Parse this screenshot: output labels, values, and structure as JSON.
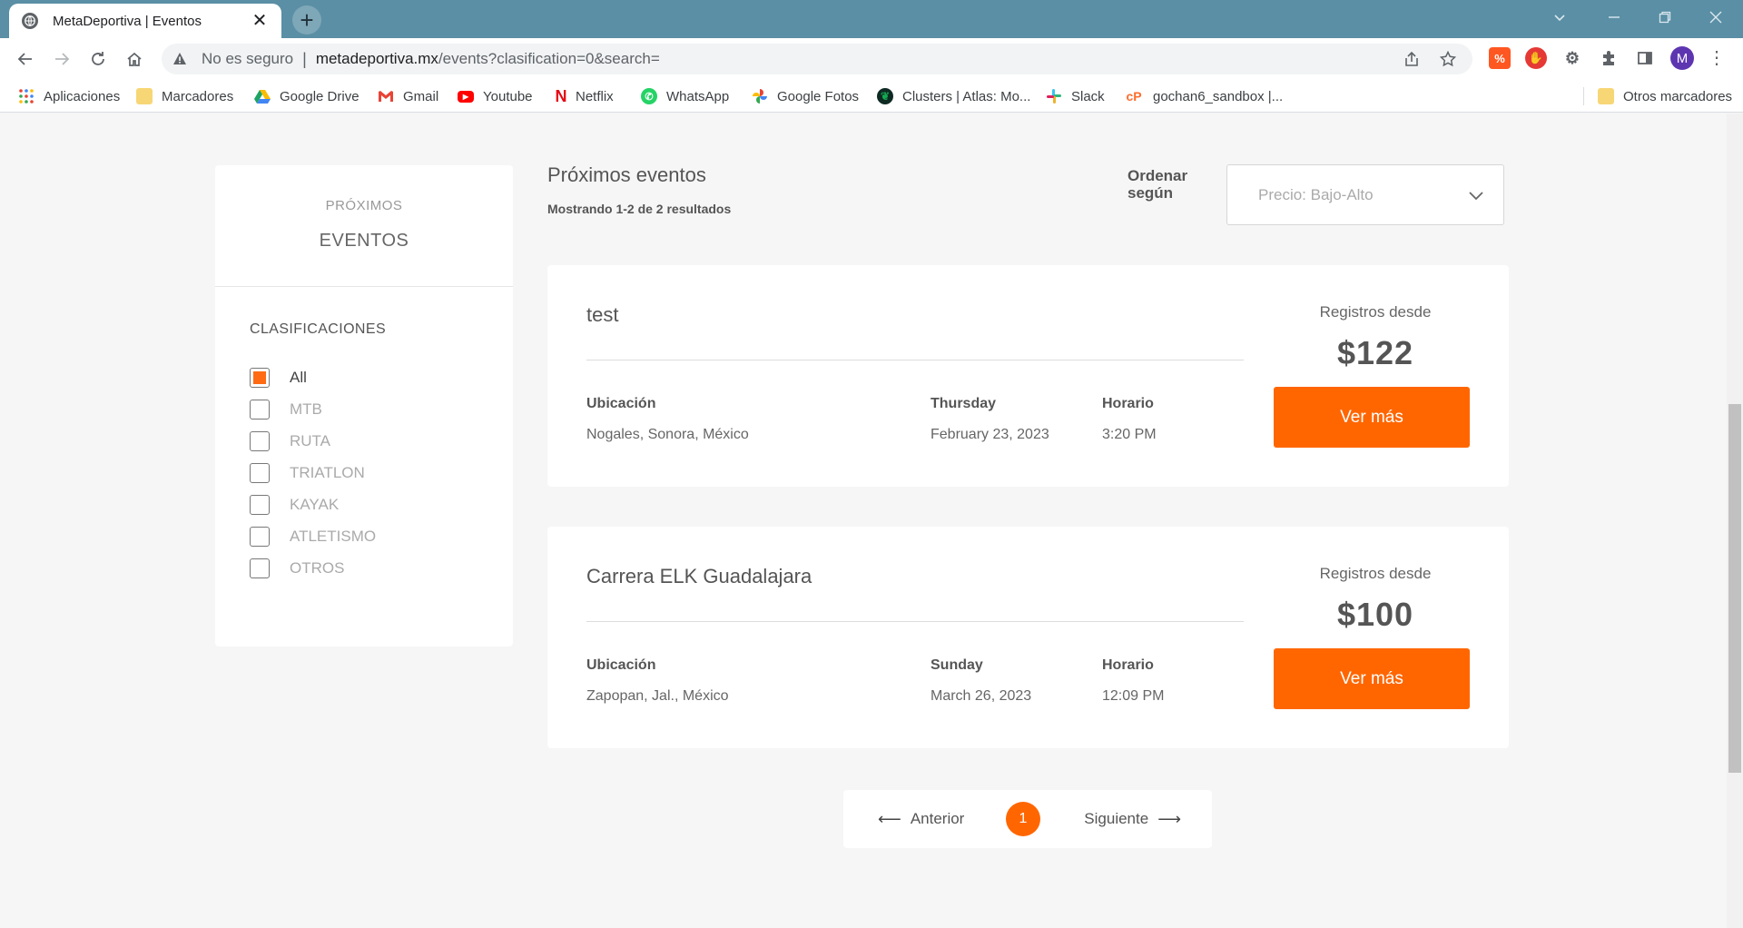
{
  "browser": {
    "tab_title": "MetaDeportiva | Eventos",
    "tab_close": "✕",
    "new_tab": "+",
    "insecure_label": "No es seguro",
    "url_host": "metadeportiva.mx",
    "url_rest": "/events?clasification=0&search=",
    "profile_initial": "M",
    "bookmarks": [
      {
        "label": "Aplicaciones",
        "icon": "apps-grid-icon",
        "color": "#ea4335"
      },
      {
        "label": "Marcadores",
        "icon": "folder-icon",
        "color": "#f7d675"
      },
      {
        "label": "Google Drive",
        "icon": "google-drive-icon",
        "color": "#1fa463"
      },
      {
        "label": "Gmail",
        "icon": "gmail-icon",
        "color": "#ea4335"
      },
      {
        "label": "Youtube",
        "icon": "youtube-icon",
        "color": "#ff0000"
      },
      {
        "label": "Netflix",
        "icon": "netflix-icon",
        "color": "#e50914"
      },
      {
        "label": "WhatsApp",
        "icon": "whatsapp-icon",
        "color": "#25d366"
      },
      {
        "label": "Google Fotos",
        "icon": "google-photos-icon",
        "color": "#fbbc04"
      },
      {
        "label": "Clusters | Atlas: Mo...",
        "icon": "mongodb-icon",
        "color": "#13aa52"
      },
      {
        "label": "Slack",
        "icon": "slack-icon",
        "color": "#4a154b"
      },
      {
        "label": "gochan6_sandbox |...",
        "icon": "cpanel-icon",
        "color": "#ff6c2c"
      }
    ],
    "other_bookmarks": "Otros marcadores"
  },
  "sidebar": {
    "small_title": "PRÓXIMOS",
    "big_title": "EVENTOS",
    "section_title": "CLASIFICACIONES",
    "filters": [
      {
        "label": "All",
        "checked": true
      },
      {
        "label": "MTB",
        "checked": false
      },
      {
        "label": "RUTA",
        "checked": false
      },
      {
        "label": "TRIATLON",
        "checked": false
      },
      {
        "label": "KAYAK",
        "checked": false
      },
      {
        "label": "ATLETISMO",
        "checked": false
      },
      {
        "label": "OTROS",
        "checked": false
      }
    ]
  },
  "main": {
    "title": "Próximos eventos",
    "subtitle": "Mostrando 1-2 de 2 resultados",
    "sort_label": "Ordenar según",
    "sort_value": "Precio: Bajo-Alto",
    "events": [
      {
        "name": "test",
        "location_label": "Ubicación",
        "location": "Nogales, Sonora, México",
        "day": "Thursday",
        "date": "February 23, 2023",
        "time_label": "Horario",
        "time": "3:20 PM",
        "from_label": "Registros desde",
        "price": "$122",
        "button": "Ver más"
      },
      {
        "name": "Carrera ELK Guadalajara",
        "location_label": "Ubicación",
        "location": "Zapopan, Jal., México",
        "day": "Sunday",
        "date": "March 26, 2023",
        "time_label": "Horario",
        "time": "12:09 PM",
        "from_label": "Registros desde",
        "price": "$100",
        "button": "Ver más"
      }
    ],
    "pagination": {
      "prev": "Anterior",
      "next": "Siguiente",
      "current": "1",
      "prev_arrow": "⟵",
      "next_arrow": "⟶"
    }
  },
  "colors": {
    "accent": "#ff6600",
    "tabstrip": "#5a8fa5"
  }
}
